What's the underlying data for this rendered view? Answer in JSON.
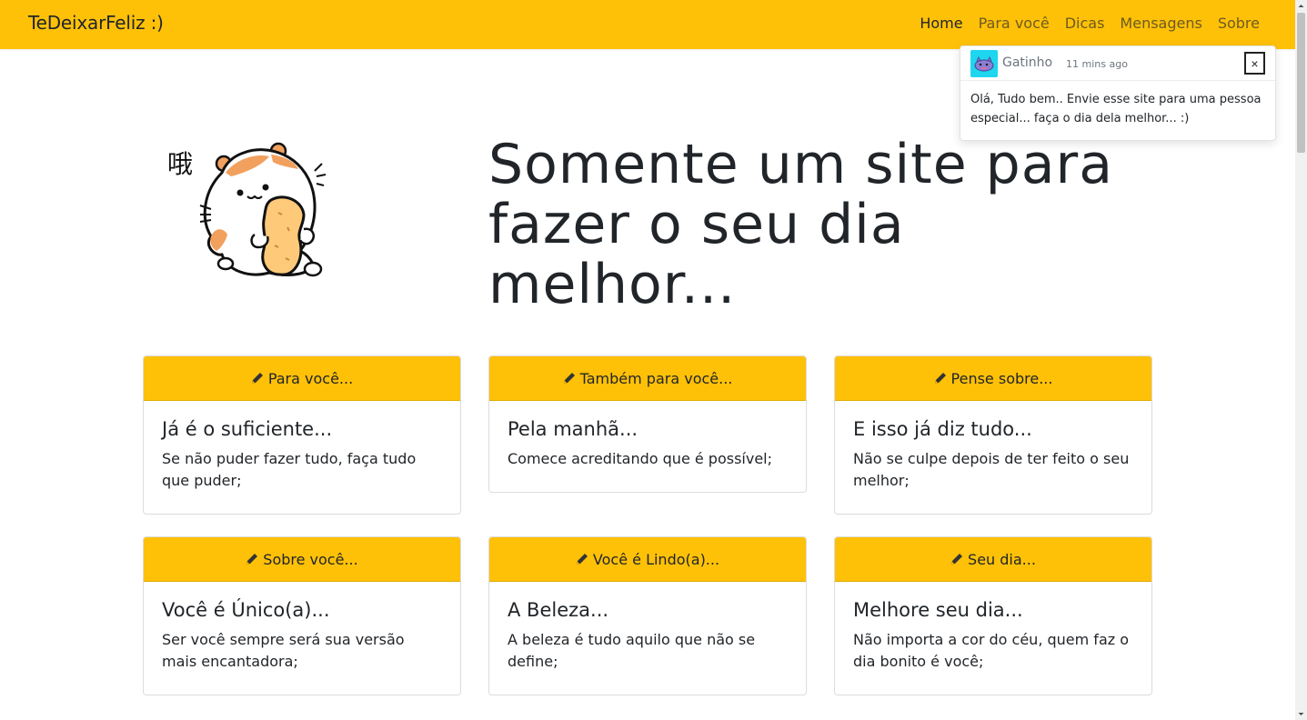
{
  "navbar": {
    "brand": "TeDeixarFeliz :)",
    "links": [
      {
        "label": "Home",
        "active": true
      },
      {
        "label": "Para você",
        "active": false
      },
      {
        "label": "Dicas",
        "active": false
      },
      {
        "label": "Mensagens",
        "active": false
      },
      {
        "label": "Sobre",
        "active": false
      }
    ]
  },
  "toast": {
    "name": "Gatinho",
    "time": "11 mins ago",
    "close_label": "×",
    "message": "Olá, Tudo bem.. Envie esse site para uma pessoa especial... faça o dia dela melhor... :)"
  },
  "hero": {
    "title": "Somente um site para fazer o seu dia melhor...",
    "image_glyph": "哦"
  },
  "cards": [
    {
      "header": "Para você...",
      "title": "Já é o suficiente...",
      "text": "Se não puder fazer tudo, faça tudo que puder;"
    },
    {
      "header": "Também para você...",
      "title": "Pela manhã...",
      "text": "Comece acreditando que é possível;"
    },
    {
      "header": "Pense sobre...",
      "title": "E isso já diz tudo...",
      "text": "Não se culpe depois de ter feito o seu melhor;"
    },
    {
      "header": "Sobre você...",
      "title": "Você é Único(a)...",
      "text": "Ser você sempre será sua versão mais encantadora;"
    },
    {
      "header": "Você é Lindo(a)...",
      "title": "A Beleza...",
      "text": "A beleza é tudo aquilo que não se define;"
    },
    {
      "header": "Seu dia...",
      "title": "Melhore seu dia...",
      "text": "Não importa a cor do céu, quem faz o dia bonito é você;"
    }
  ],
  "colors": {
    "accent": "#ffc107",
    "text": "#212529"
  },
  "icons": {
    "card_header": "pencil-icon",
    "toast_avatar": "cat-avatar-icon"
  }
}
